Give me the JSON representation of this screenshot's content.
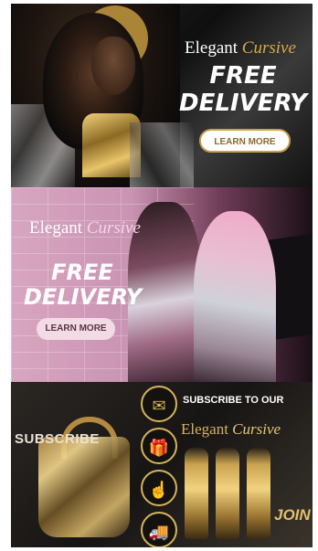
{
  "banner1": {
    "brand_word": "Elegant",
    "brand_script": "Cursive",
    "headline_line1": "FREE",
    "headline_line2": "DELIVERY",
    "button": "LEARN MORE"
  },
  "banner2": {
    "brand_word": "Elegant",
    "brand_script": "Cursive",
    "headline_line1": "FREE",
    "headline_line2": "DELIVERY",
    "button": "LEARN MORE"
  },
  "banner3": {
    "left_text": "SUBSCRIBE",
    "headline": "SUBSCRIBE TO OUR",
    "brand_word": "Elegant",
    "brand_script": "Cursive",
    "join": "JOIN",
    "icons": [
      "newsletter-icon",
      "gift-sale-icon",
      "buy-now-icon",
      "delivery-truck-icon"
    ]
  },
  "colors": {
    "gold": "#d7b45a",
    "pink": "#d8a6c1",
    "dark": "#111111"
  }
}
